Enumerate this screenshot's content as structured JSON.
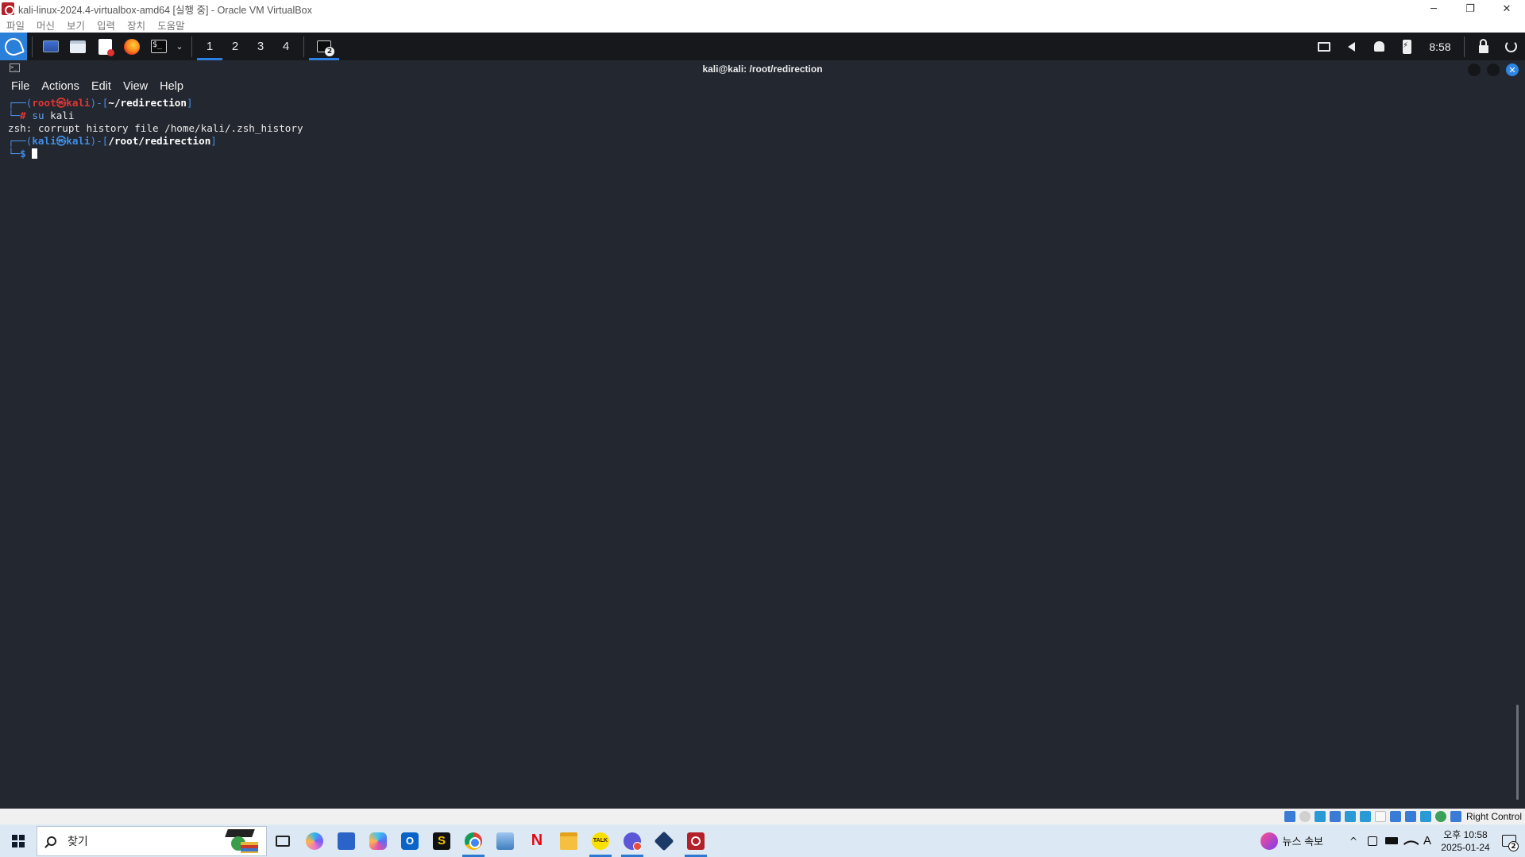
{
  "host_window": {
    "title": "kali-linux-2024.4-virtualbox-amd64 [실행 중] - Oracle VM VirtualBox",
    "menu": [
      "파일",
      "머신",
      "보기",
      "입력",
      "장치",
      "도움말"
    ],
    "controls": {
      "minimize": "─",
      "restore": "❐",
      "close": "✕"
    }
  },
  "kali_panel": {
    "workspaces": [
      "1",
      "2",
      "3",
      "4"
    ],
    "active_workspace": "1",
    "task_badge": "2",
    "clock": "8:58",
    "launchers": [
      "desktop-icon",
      "file-manager-icon",
      "text-editor-icon",
      "firefox-icon",
      "terminal-icon"
    ]
  },
  "terminal": {
    "window_title": "kali@kali: /root/redirection",
    "menu": [
      "File",
      "Actions",
      "Edit",
      "View",
      "Help"
    ],
    "lines": {
      "l1": {
        "corner": "┌──(",
        "user": "root",
        "at": "㉿",
        "host": "kali",
        "mid": ")-[",
        "path": "~/redirection",
        "end": "]"
      },
      "l2": {
        "corner": "└─",
        "symbol": "#",
        "cmd": "su",
        "args": "kali"
      },
      "l3": {
        "text": "zsh: corrupt history file /home/kali/.zsh_history"
      },
      "l4": {
        "corner": "┌──(",
        "user": "kali",
        "at": "㉿",
        "host": "kali",
        "mid": ")-[",
        "path": "/root/redirection",
        "end": "]"
      },
      "l5": {
        "corner": "└─",
        "symbol": "$"
      }
    }
  },
  "vb_statusbar": {
    "host_key": "Right Control"
  },
  "windows_taskbar": {
    "search_placeholder": "찾기",
    "apps": [
      "task-view",
      "copilot",
      "microsoft-store",
      "microsoft-365",
      "outlook",
      "s-app",
      "chrome",
      "photos",
      "netflix",
      "file-explorer",
      "kakaotalk",
      "chat-app",
      "virtualbox",
      "virtualbox-vm"
    ],
    "outlook_letter": "O",
    "s_letter": "S",
    "netflix_letter": "N",
    "talk_label": "TALK",
    "news": "뉴스 속보",
    "ime": "A",
    "clock_time": "오후 10:58",
    "clock_date": "2025-01-24",
    "notification_count": "2"
  }
}
